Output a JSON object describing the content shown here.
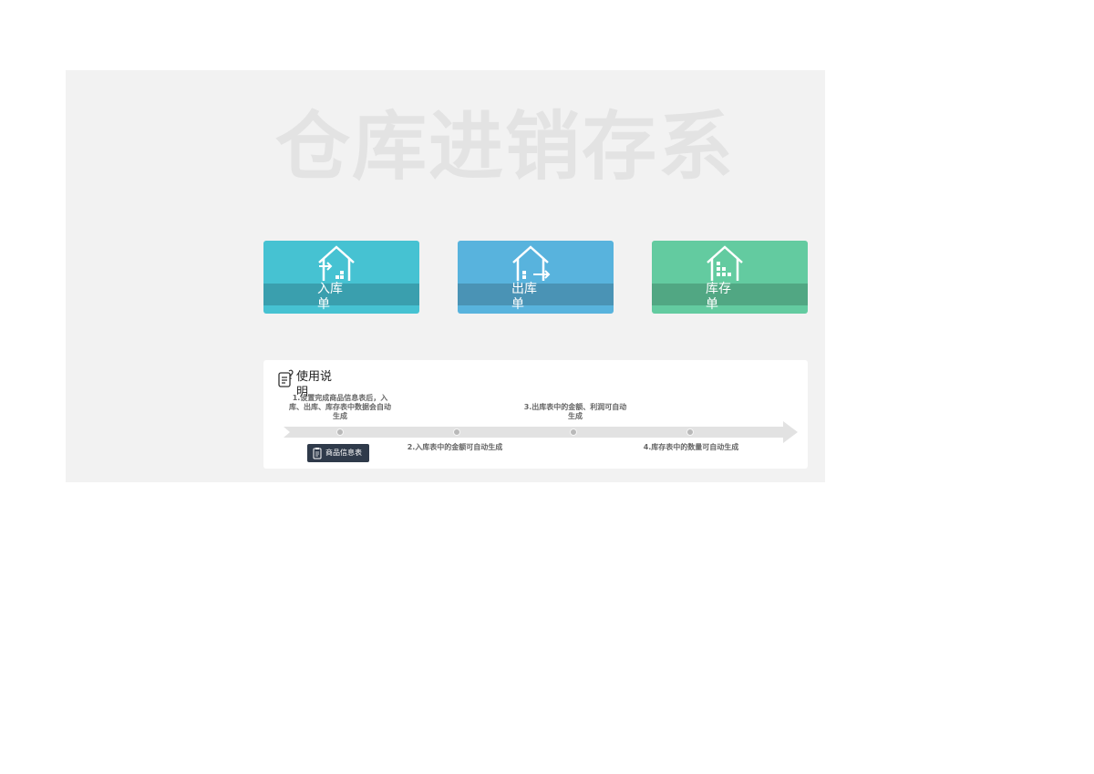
{
  "watermark_title": "仓库进销存系",
  "tiles": [
    {
      "label": "入库单",
      "icon": "house-inbound-icon",
      "color": "#46c2d2"
    },
    {
      "label": "出库单",
      "icon": "house-outbound-icon",
      "color": "#58b3dd"
    },
    {
      "label": "库存单",
      "icon": "house-inventory-icon",
      "color": "#63cba0"
    }
  ],
  "instructions": {
    "title": "使用说明",
    "icon": "notes-icon",
    "steps": [
      "1.设置完成商品信息表后，入库、出库、库存表中数据会自动生成",
      "2.入库表中的金额可自动生成",
      "3.出库表中的金额、利润可自动生成",
      "4.库存表中的数量可自动生成"
    ],
    "button_label": "商品信息表"
  }
}
